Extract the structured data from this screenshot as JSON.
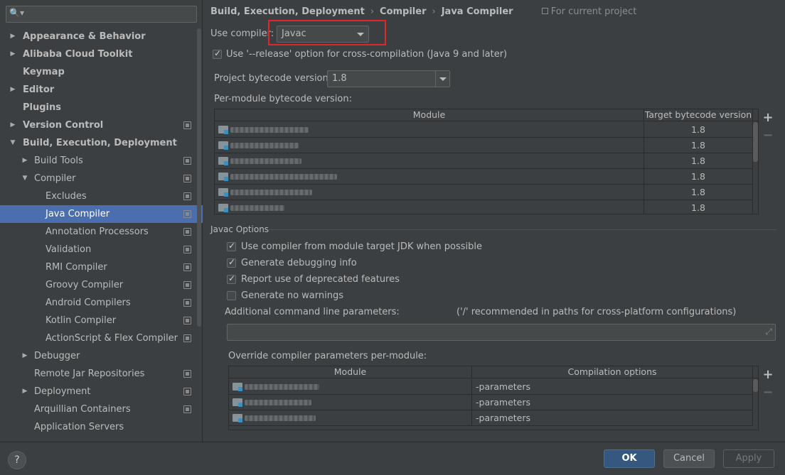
{
  "sidebar": {
    "search": {
      "value": "",
      "placeholder": ""
    },
    "items": [
      {
        "label": "Appearance & Behavior",
        "arrow": "▶",
        "bold": true
      },
      {
        "label": "Alibaba Cloud Toolkit",
        "arrow": "▶",
        "bold": true
      },
      {
        "label": "Keymap",
        "arrow": "",
        "bold": true
      },
      {
        "label": "Editor",
        "arrow": "▶",
        "bold": true
      },
      {
        "label": "Plugins",
        "arrow": "",
        "bold": true
      },
      {
        "label": "Version Control",
        "arrow": "▶",
        "bold": true
      },
      {
        "label": "Build, Execution, Deployment",
        "arrow": "▼",
        "bold": true
      },
      {
        "label": "Build Tools",
        "arrow": "▶"
      },
      {
        "label": "Compiler",
        "arrow": "▼"
      },
      {
        "label": "Excludes"
      },
      {
        "label": "Java Compiler"
      },
      {
        "label": "Annotation Processors"
      },
      {
        "label": "Validation"
      },
      {
        "label": "RMI Compiler"
      },
      {
        "label": "Groovy Compiler"
      },
      {
        "label": "Android Compilers"
      },
      {
        "label": "Kotlin Compiler"
      },
      {
        "label": "ActionScript & Flex Compiler"
      },
      {
        "label": "Debugger",
        "arrow": "▶"
      },
      {
        "label": "Remote Jar Repositories"
      },
      {
        "label": "Deployment",
        "arrow": "▶"
      },
      {
        "label": "Arquillian Containers"
      },
      {
        "label": "Application Servers"
      }
    ]
  },
  "breadcrumb": {
    "items": [
      "Build, Execution, Deployment",
      "Compiler",
      "Java Compiler"
    ],
    "separator": "›",
    "note": "For current project"
  },
  "compiler": {
    "use_compiler_label": "Use compiler:",
    "use_compiler_value": "Javac",
    "release_option_label": "Use '--release' option for cross-compilation (Java 9 and later)",
    "release_option_checked": true,
    "project_bytecode_label": "Project bytecode version:",
    "project_bytecode_value": "1.8",
    "per_module_label": "Per-module bytecode version:"
  },
  "module_table": {
    "headers": [
      "Module",
      "Target bytecode version"
    ],
    "rows": [
      "1.8",
      "1.8",
      "1.8",
      "1.8",
      "1.8",
      "1.8"
    ]
  },
  "javac_options": {
    "title": "Javac Options",
    "checkboxes": [
      {
        "label": "Use compiler from module target JDK when possible",
        "checked": true
      },
      {
        "label": "Generate debugging info",
        "checked": true
      },
      {
        "label": "Report use of deprecated features",
        "checked": true
      },
      {
        "label": "Generate no warnings",
        "checked": false
      }
    ],
    "additional_label": "Additional command line parameters:",
    "additional_hint": "('/' recommended in paths for cross-platform configurations)",
    "additional_value": "",
    "override_label": "Override compiler parameters per-module:"
  },
  "override_table": {
    "headers": [
      "Module",
      "Compilation options"
    ],
    "rows": [
      "-parameters",
      "-parameters",
      "-parameters"
    ]
  },
  "icons": {
    "add": "+",
    "remove": "−",
    "help": "?"
  },
  "buttons": {
    "ok": "OK",
    "cancel": "Cancel",
    "apply": "Apply"
  },
  "colors": {
    "selection": "#4b6eaf",
    "highlight_box": "#e0262a",
    "primary_button": "#365880"
  }
}
